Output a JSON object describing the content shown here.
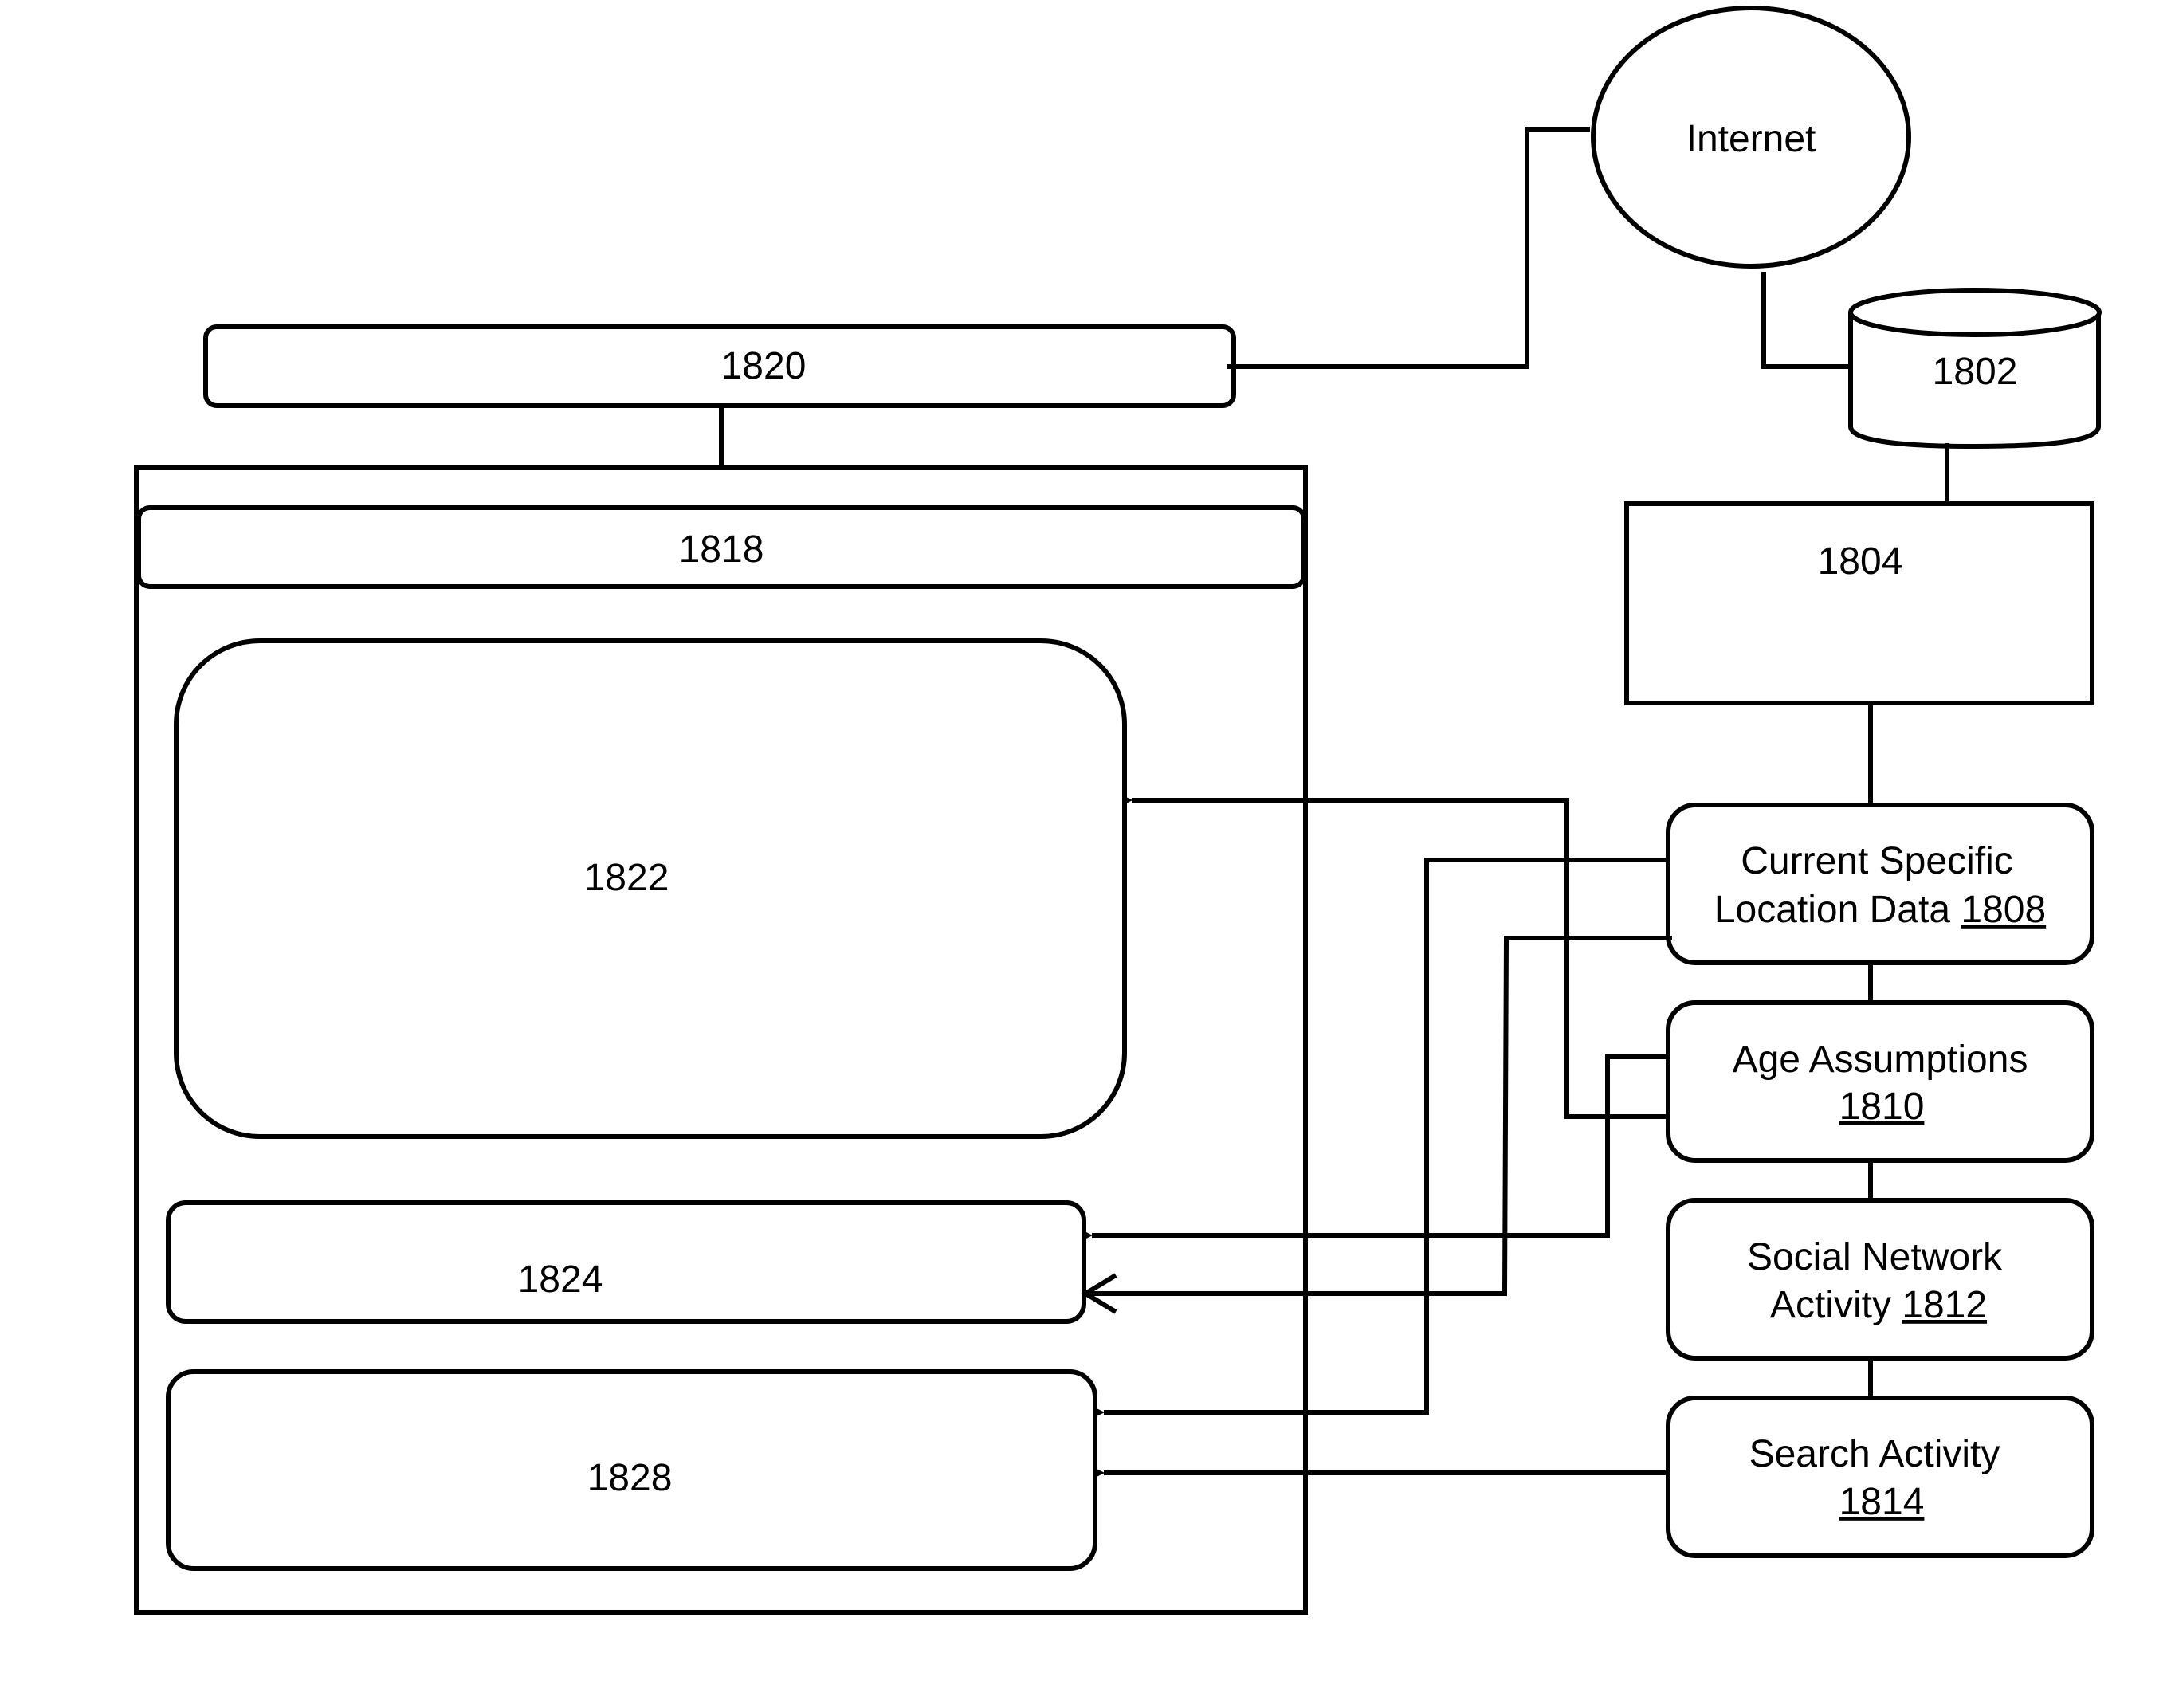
{
  "diagram": {
    "internet": {
      "label": "Internet"
    },
    "database": {
      "label": "1802"
    },
    "server": {
      "label": "1804"
    },
    "network_bar": {
      "label": "1820"
    },
    "device": {
      "header": {
        "label": "1818"
      },
      "panel_main": {
        "label": "1822"
      },
      "panel_middle": {
        "label": "1824"
      },
      "panel_bottom": {
        "label": "1828"
      }
    },
    "data_sources": [
      {
        "line1": "Current  Specific",
        "line2_prefix": "Location Data ",
        "ref": "1808"
      },
      {
        "line1": "Age Assumptions",
        "line2_prefix": "",
        "ref": "1810"
      },
      {
        "line1": "Social Network",
        "line2_prefix": "Activity ",
        "ref": "1812"
      },
      {
        "line1": "Search Activity",
        "line2_prefix": "",
        "ref": "1814"
      }
    ],
    "colors": {
      "stroke": "#000000",
      "background": "#ffffff"
    }
  }
}
